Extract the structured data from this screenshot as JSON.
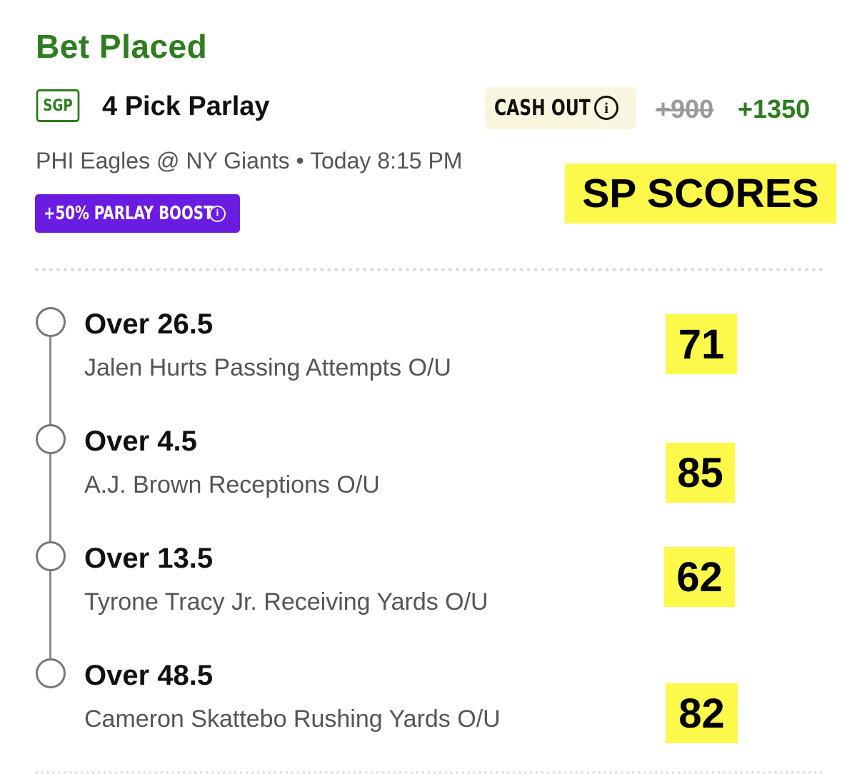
{
  "bet": {
    "status": "Bet Placed",
    "badge": "SGP",
    "title": "4 Pick Parlay",
    "cash_out_label": "CASH OUT",
    "old_odds": "+900",
    "new_odds": "+1350",
    "matchup": "PHI Eagles @ NY Giants • Today 8:15 PM",
    "boost_label": "+50% PARLAY BOOST"
  },
  "overlay": {
    "label": "SP SCORES"
  },
  "legs": [
    {
      "pick": "Over 26.5",
      "market": "Jalen Hurts Passing Attempts O/U",
      "score": "71"
    },
    {
      "pick": "Over 4.5",
      "market": "A.J. Brown Receptions O/U",
      "score": "85"
    },
    {
      "pick": "Over 13.5",
      "market": "Tyrone Tracy Jr. Receiving Yards O/U",
      "score": "62"
    },
    {
      "pick": "Over 48.5",
      "market": "Cameron Skattebo Rushing Yards O/U",
      "score": "82"
    }
  ],
  "colors": {
    "accent_green": "#2e7d1f",
    "boost_purple": "#6a1de0",
    "highlight_yellow": "#fcf94b",
    "cash_out_bg": "#fbf6e0"
  },
  "icons": {
    "info": "info-circle-icon",
    "leg_status": "empty-circle-icon"
  }
}
